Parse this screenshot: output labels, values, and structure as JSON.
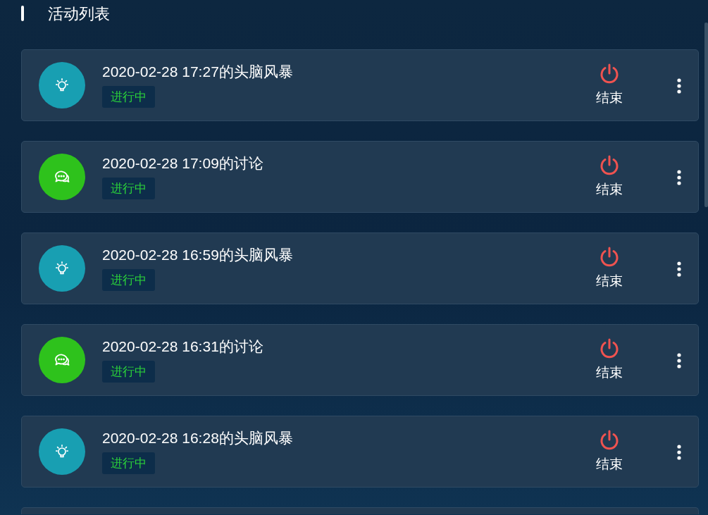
{
  "header": {
    "title": "活动列表"
  },
  "activities": [
    {
      "kind": "brainstorm",
      "title": "2020-02-28 17:27的头脑风暴",
      "status": "进行中",
      "action": "结束"
    },
    {
      "kind": "discussion",
      "title": "2020-02-28 17:09的讨论",
      "status": "进行中",
      "action": "结束"
    },
    {
      "kind": "brainstorm",
      "title": "2020-02-28 16:59的头脑风暴",
      "status": "进行中",
      "action": "结束"
    },
    {
      "kind": "discussion",
      "title": "2020-02-28 16:31的讨论",
      "status": "进行中",
      "action": "结束"
    },
    {
      "kind": "brainstorm",
      "title": "2020-02-28 16:28的头脑风暴",
      "status": "进行中",
      "action": "结束"
    }
  ]
}
